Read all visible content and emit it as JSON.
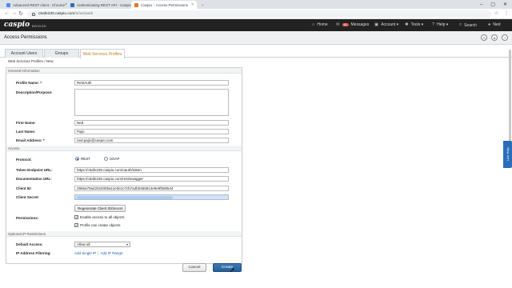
{
  "browser": {
    "tabs": [
      {
        "title": "Advanced REST client - Chrome",
        "active": false,
        "favicon_color": "#4a8af4"
      },
      {
        "title": "Authenticating REST API - Caspio",
        "active": false,
        "favicon_color": "#2a6ebb"
      },
      {
        "title": "Caspio :: Access Permissions",
        "active": true,
        "favicon_color": "#e5762a"
      }
    ],
    "url_host": "c5afe230.caspio.com",
    "url_path": "/ui/ws/auth",
    "window_controls": [
      "–",
      "▢",
      "✕"
    ]
  },
  "topnav": {
    "logo": "caspio",
    "logo_sub": "BRIDGE",
    "items": [
      {
        "label": "Home",
        "icon": "home-icon",
        "glyph": "⌂"
      },
      {
        "label": "Messages",
        "icon": "mail-icon",
        "glyph": "✉",
        "badge": "51"
      },
      {
        "label": "Account ▾",
        "icon": "account-icon",
        "glyph": "▣"
      },
      {
        "label": "Tools ▾",
        "icon": "tools-icon",
        "glyph": "✱"
      },
      {
        "label": "Help ▾",
        "icon": "help-icon",
        "glyph": "?"
      },
      {
        "label": "Search",
        "icon": "search-icon",
        "glyph": "⌕"
      },
      {
        "label": "Ned",
        "icon": "user-icon",
        "glyph": "●"
      }
    ]
  },
  "page": {
    "title": "Access Permissions",
    "tabs": [
      "Account Users",
      "Groups",
      "Web Services Profiles"
    ],
    "active_tab": 2,
    "breadcrumb_link": "Web Services Profiles",
    "breadcrumb_sep": "/",
    "breadcrumb_current": "New"
  },
  "form": {
    "sections": {
      "general": "General Information",
      "access": "Access",
      "optional": "Optional IP Restrictions"
    },
    "labels": {
      "profile_name": "Profile Name: *",
      "description": "Description/Purpose:",
      "first_name": "First Name:",
      "last_name": "Last Name:",
      "email": "Email Address: *",
      "protocol": "Protocol:",
      "token_url": "Token Endpoint URL:",
      "doc_url": "Documentation URL:",
      "client_id": "Client ID:",
      "client_secret": "Client Secret:",
      "permissions": "Permissions:",
      "default_access": "Default Access:",
      "ip_filtering": "IP Address Filtering:"
    },
    "values": {
      "profile_name": "RestAuth",
      "description": "",
      "first_name": "Ned",
      "last_name": "Pajic",
      "email": "ned.pajic@caspio.com",
      "token_url": "https://c5afe230.caspio.com/oauth/token",
      "doc_url": "https://c5afe230.caspio.com/rest/swagger",
      "client_id": "2966a70a42024005a11e3e1c7cb7a4b0465814e9e9f568544"
    },
    "protocol_options": [
      "REST",
      "SOAP"
    ],
    "protocol_selected": "REST",
    "regenerate_label": "Regenerate Client ID/Secret",
    "permissions": [
      {
        "label": "Enable access to all objects",
        "checked": true
      },
      {
        "label": "Profile can create objects",
        "checked": true
      }
    ],
    "default_access": "Allow all",
    "ip_links": [
      "Add Single IP",
      "Add IP Range"
    ],
    "cancel_label": "Cancel",
    "create_label": "Create"
  },
  "side_widget": {
    "label": "Live Help"
  }
}
